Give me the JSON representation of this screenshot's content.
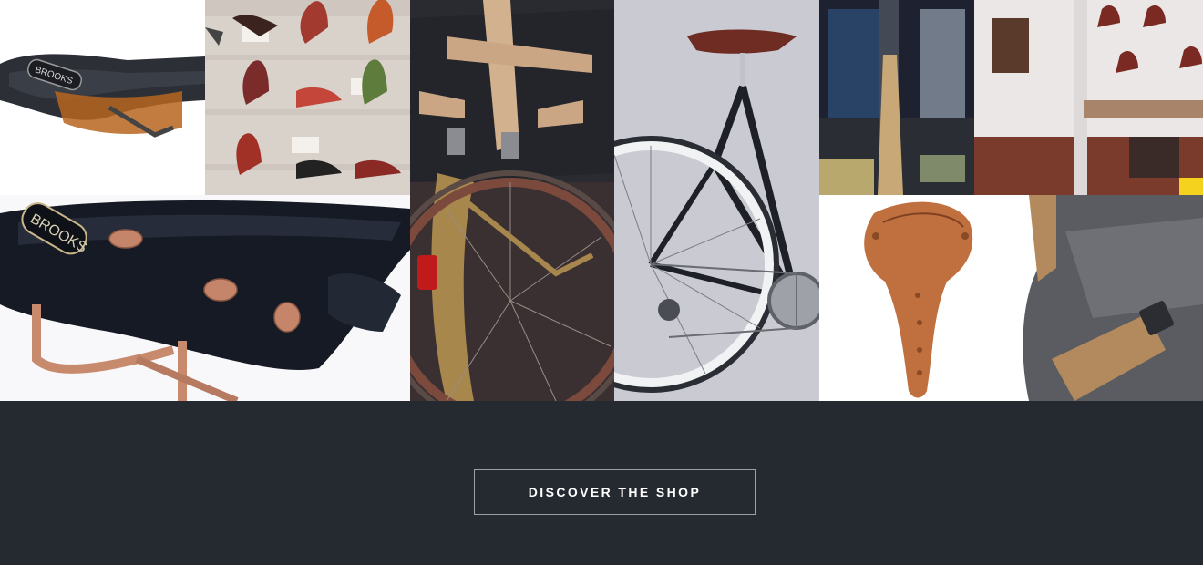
{
  "gallery": {
    "tiles": [
      {
        "name": "saddle-black-top",
        "brand_text": "BROOKS"
      },
      {
        "name": "saddle-wall-display"
      },
      {
        "name": "pannier-bag-bike"
      },
      {
        "name": "road-bike-frame"
      },
      {
        "name": "shop-interior"
      },
      {
        "name": "saddle-copper-engraved"
      },
      {
        "name": "saddle-black-closeup",
        "brand_text": "BROOKS"
      }
    ]
  },
  "cta": {
    "label": "DISCOVER THE SHOP"
  },
  "colors": {
    "footer_bg": "#252a31",
    "cta_border": "#9aa0a6",
    "cta_text": "#ffffff"
  }
}
